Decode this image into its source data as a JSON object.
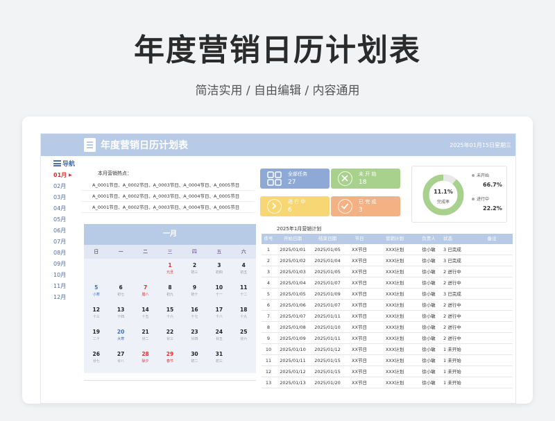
{
  "hero": {
    "title": "年度营销日历计划表",
    "subtitle": "简洁实用 / 自由编辑 / 内容通用"
  },
  "sheet": {
    "title": "年度营销日历计划表",
    "date": "2025年01月15日",
    "weekday": "星期三"
  },
  "nav": {
    "label": "导航",
    "months": [
      "01月",
      "02月",
      "03月",
      "04月",
      "05月",
      "06月",
      "07月",
      "08月",
      "09月",
      "10月",
      "11月",
      "12月"
    ],
    "active_index": 0,
    "active_marker": "▶"
  },
  "hotspots": {
    "title": "本月营销热点：",
    "rows": [
      "A_0001节日、A_0002节日、A_0003节日、A_0004节日、A_0005节日",
      "A_0001节日、A_0002节日、A_0003节日、A_0004节日、A_0005节日",
      "A_0001节日、A_0002节日、A_0003节日、A_0004节日、A_0005节日"
    ]
  },
  "calendar": {
    "month": "一月",
    "weekdays": [
      "日",
      "一",
      "二",
      "三",
      "四",
      "五",
      "六"
    ],
    "cells": [
      {
        "d": "",
        "l": ""
      },
      {
        "d": "",
        "l": ""
      },
      {
        "d": "",
        "l": ""
      },
      {
        "d": "1",
        "l": "元旦",
        "style": "red"
      },
      {
        "d": "2",
        "l": "初三"
      },
      {
        "d": "3",
        "l": "初四"
      },
      {
        "d": "4",
        "l": "初五"
      },
      {
        "d": "5",
        "l": "小寒",
        "style": "blue"
      },
      {
        "d": "6",
        "l": "初七"
      },
      {
        "d": "7",
        "l": "腊八",
        "style": "red"
      },
      {
        "d": "8",
        "l": "初九"
      },
      {
        "d": "9",
        "l": "初十"
      },
      {
        "d": "10",
        "l": "十一"
      },
      {
        "d": "11",
        "l": "十二"
      },
      {
        "d": "12",
        "l": "十三"
      },
      {
        "d": "13",
        "l": "十四"
      },
      {
        "d": "14",
        "l": "十五"
      },
      {
        "d": "15",
        "l": "十六"
      },
      {
        "d": "16",
        "l": "十七"
      },
      {
        "d": "17",
        "l": "十八"
      },
      {
        "d": "18",
        "l": "十九"
      },
      {
        "d": "19",
        "l": "二十"
      },
      {
        "d": "20",
        "l": "大寒",
        "style": "blue"
      },
      {
        "d": "21",
        "l": "廿二"
      },
      {
        "d": "22",
        "l": "廿三"
      },
      {
        "d": "23",
        "l": "廿四"
      },
      {
        "d": "24",
        "l": "廿五"
      },
      {
        "d": "25",
        "l": "廿六"
      },
      {
        "d": "26",
        "l": "廿七"
      },
      {
        "d": "27",
        "l": "廿八"
      },
      {
        "d": "28",
        "l": "除夕",
        "style": "red"
      },
      {
        "d": "29",
        "l": "春节",
        "style": "red"
      },
      {
        "d": "30",
        "l": "初二"
      },
      {
        "d": "31",
        "l": "初三"
      },
      {
        "d": "",
        "l": ""
      }
    ],
    "footer": [
      "",
      ""
    ]
  },
  "stats": [
    {
      "label": "全部任务",
      "value": "27",
      "color": "#8fa9d6",
      "icon": "grid-icon"
    },
    {
      "label": "未 开 始",
      "value": "18",
      "color": "#a9d18e",
      "icon": "close-icon"
    },
    {
      "label": "进 行 中",
      "value": "6",
      "color": "#f7d774",
      "icon": "arrow-right-icon"
    },
    {
      "label": "已 完 成",
      "value": "3",
      "color": "#f4b183",
      "icon": "check-icon"
    }
  ],
  "donut": {
    "percent": "11.1%",
    "label": "完成率",
    "fraction": 0.111,
    "ring_color": "#a9d18e",
    "done_color": "#e8e8e8",
    "legend": [
      {
        "label": "未开始",
        "value": "66.7%"
      },
      {
        "label": "进行中",
        "value": "22.2%"
      }
    ]
  },
  "table": {
    "title": "2025年1月营销计划",
    "headers": [
      "序号",
      "开始日期",
      "结束日期",
      "节日",
      "营销计划",
      "负责人",
      "状态",
      "备注"
    ],
    "rows": [
      [
        "1",
        "2025/01/01",
        "2025/01/05",
        "XX节日",
        "XXX计划",
        "徐小敏",
        "3  已完成",
        ""
      ],
      [
        "2",
        "2025/01/02",
        "2025/01/04",
        "XX节日",
        "XXX计划",
        "徐小敏",
        "3  已完成",
        ""
      ],
      [
        "3",
        "2025/01/03",
        "2025/01/05",
        "XX节日",
        "XXX计划",
        "徐小敏",
        "2  进行中",
        ""
      ],
      [
        "4",
        "2025/01/04",
        "2025/01/07",
        "XX节日",
        "XXX计划",
        "徐小敏",
        "2  进行中",
        ""
      ],
      [
        "5",
        "2025/01/05",
        "2025/01/09",
        "XX节日",
        "XXX计划",
        "徐小敏",
        "3  已完成",
        ""
      ],
      [
        "6",
        "2025/01/06",
        "2025/01/07",
        "XX节日",
        "XXX计划",
        "徐小敏",
        "2  进行中",
        ""
      ],
      [
        "7",
        "2025/01/07",
        "2025/01/11",
        "XX节日",
        "XXX计划",
        "徐小敏",
        "2  进行中",
        ""
      ],
      [
        "8",
        "2025/01/08",
        "2025/01/10",
        "XX节日",
        "XXX计划",
        "徐小敏",
        "2  进行中",
        ""
      ],
      [
        "9",
        "2025/01/09",
        "2025/01/11",
        "XX节日",
        "XXX计划",
        "徐小敏",
        "2  进行中",
        ""
      ],
      [
        "10",
        "2025/01/10",
        "2025/01/12",
        "XX节日",
        "XXX计划",
        "徐小敏",
        "1  未开始",
        ""
      ],
      [
        "11",
        "2025/01/11",
        "2025/01/15",
        "XX节日",
        "XXX计划",
        "徐小敏",
        "1  未开始",
        ""
      ],
      [
        "12",
        "2025/01/12",
        "2025/01/15",
        "XX节日",
        "XXX计划",
        "徐小敏",
        "1  未开始",
        ""
      ],
      [
        "13",
        "2025/01/13",
        "2025/01/20",
        "XX节日",
        "XXX计划",
        "徐小敏",
        "1  未开始",
        ""
      ]
    ]
  }
}
